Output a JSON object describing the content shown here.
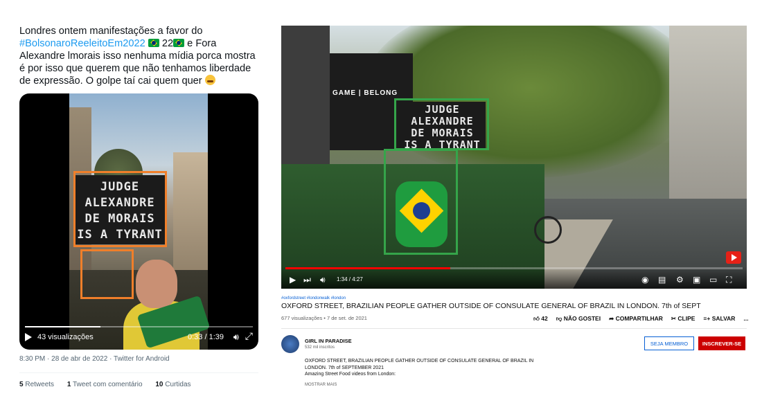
{
  "tweet": {
    "text_part1": "Londres ontem manifestações a favor do ",
    "hashtag": "#BolsonaroReeleitoEm2022",
    "text_part2": " 22",
    "text_part3": " e Fora Alexandre lmorais isso nenhuma mídia porca mostra é por isso que querem que não tenhamos liberdade de expressão. O golpe taí cai quem quer ",
    "sign_lines": [
      "JUDGE",
      "ALEXANDRE",
      "DE MORAIS",
      "IS A TYRANT"
    ],
    "views": "43 visualizações",
    "time": "0:33 / 1:39",
    "meta": "8:30 PM · 28 de abr de 2022 · Twitter for Android",
    "retweets_count": "5",
    "retweets_label": "Retweets",
    "quotes_count": "1",
    "quotes_label": "Tweet com comentário",
    "likes_count": "10",
    "likes_label": "Curtidas",
    "progress_fraction": 0.33
  },
  "youtube": {
    "store_text": "GAME | BELONG",
    "sign_lines": [
      "JUDGE",
      "ALEXANDRE",
      "DE MORAIS",
      "IS A TYRANT"
    ],
    "time": "1:34 / 4:27",
    "progress_fraction": 0.36,
    "hashtags": "#oxfordstreet #londonwalk #london",
    "title": "OXFORD STREET, BRAZILIAN PEOPLE GATHER OUTSIDE OF CONSULATE GENERAL OF BRAZIL IN LONDON. 7th of SEPT",
    "views": "677 visualizações • 7 de set. de 2021",
    "likes": "42",
    "dislike_label": "NÃO GOSTEI",
    "share_label": "COMPARTILHAR",
    "clip_label": "CLIPE",
    "save_label": "SALVAR",
    "more_label": "...",
    "channel": "GIRL IN PARADISE",
    "subscribers": "532 mil inscritos",
    "member_button": "SEJA MEMBRO",
    "subscribe_button": "INSCREVER-SE",
    "description_line1": "OXFORD STREET, BRAZILIAN PEOPLE GATHER OUTSIDE OF CONSULATE GENERAL OF BRAZIL IN",
    "description_line2": "LONDON. 7th of SEPTEMBER 2021",
    "description_line3": "Amazing Street Food videos from London:",
    "show_more": "MOSTRAR MAIS"
  },
  "colors": {
    "orange_box": "#f07f2a",
    "green_box": "#35a54a",
    "youtube_red": "#cc0000",
    "twitter_blue": "#1d9bf0"
  }
}
